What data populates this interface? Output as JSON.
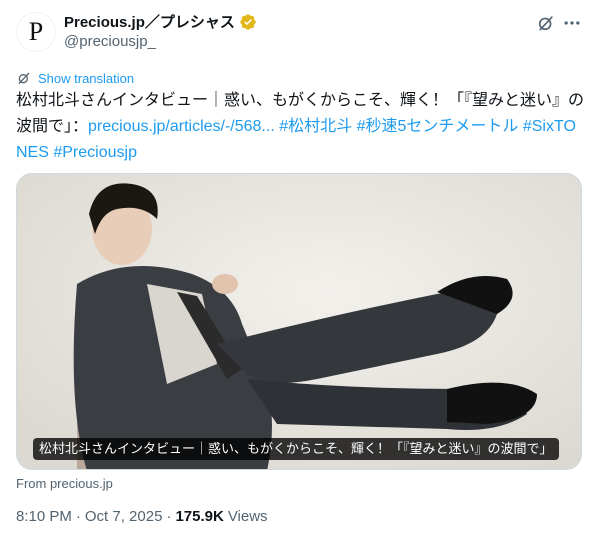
{
  "account": {
    "display_name": "Precious.jp／プレシャス",
    "handle": "@preciousjp_",
    "avatar_letter": "P",
    "verified_color": "#e2b719"
  },
  "header_icons": {
    "grok": "grok-icon",
    "more": "more-icon"
  },
  "translation": {
    "label": "Show translation"
  },
  "tweet": {
    "text_plain": "松村北斗さんインタビュー｜惑い、もがくからこそ、輝く！「『望みと迷い』の波間で」：",
    "link": "precious.jp/articles/-/568...",
    "hashtags": [
      "#松村北斗",
      "#秒速5センチメートル",
      "#SixTONES",
      "#Preciousjp"
    ]
  },
  "media": {
    "caption": "松村北斗さんインタビュー｜惑い、もがくからこそ、輝く！「『望みと迷い』の波間で」"
  },
  "card": {
    "source": "From precious.jp"
  },
  "meta": {
    "time": "8:10 PM",
    "separator": "·",
    "date": "Oct 7, 2025",
    "views_count": "175.9K",
    "views_label": "Views"
  },
  "colors": {
    "accent": "#1d9bf0",
    "text": "#0f1419",
    "secondary": "#536471"
  }
}
